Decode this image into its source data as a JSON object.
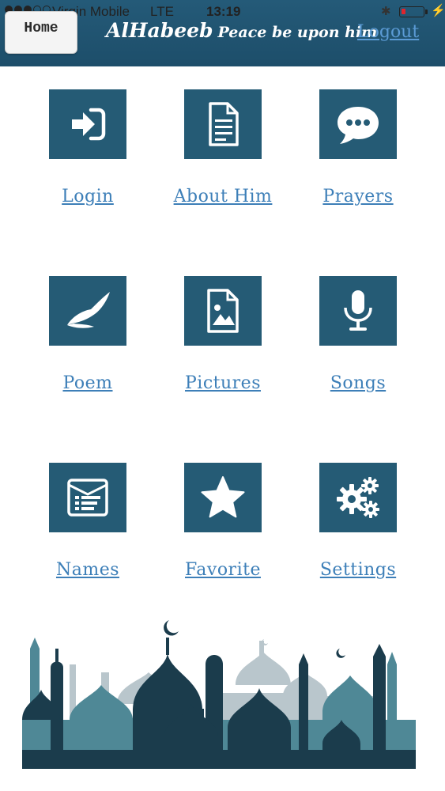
{
  "status_bar": {
    "carrier": "Virgin Mobile",
    "network": "LTE",
    "time": "13:19",
    "battery_level": 0.18,
    "battery_color": "#e0252d"
  },
  "header": {
    "home_label": "Home",
    "title_main": "AlHabeeb",
    "title_sub": "Peace be upon him",
    "logout_label": "Logout",
    "background": "#245a78"
  },
  "menu": [
    {
      "label": "Login",
      "icon": "login-icon"
    },
    {
      "label": "About Him",
      "icon": "document-icon"
    },
    {
      "label": "Prayers",
      "icon": "chat-bubble-icon"
    },
    {
      "label": "Poem",
      "icon": "quill-icon"
    },
    {
      "label": "Pictures",
      "icon": "image-file-icon"
    },
    {
      "label": "Songs",
      "icon": "microphone-icon"
    },
    {
      "label": "Names",
      "icon": "list-card-icon"
    },
    {
      "label": "Favorite",
      "icon": "star-icon"
    },
    {
      "label": "Settings",
      "icon": "gears-icon"
    }
  ],
  "colors": {
    "tile": "#255b75",
    "link": "#3d7fb8"
  }
}
